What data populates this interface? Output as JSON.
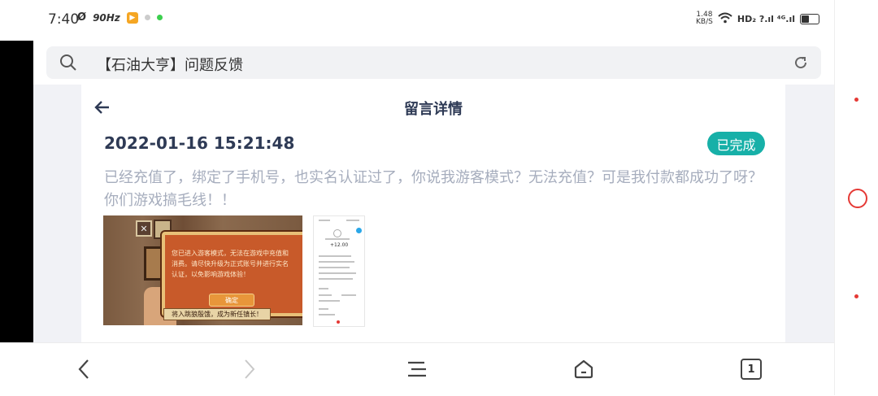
{
  "status_bar": {
    "time": "7:40",
    "refresh_rate": "90Hz",
    "speed_value": "1.48",
    "speed_unit": "KB/S",
    "network": "HD₂ ?.ıl ⁴ᴳ.ıl"
  },
  "browser": {
    "address_text": "【石油大亨】问题反馈",
    "tab_count": "1"
  },
  "page": {
    "title": "留言详情",
    "message_time": "2022-01-16 15:21:48",
    "status_badge": "已完成",
    "message_text": "已经充值了，绑定了手机号，也实名认证过了，你说我游客模式？无法充值？可是我付款都成功了呀？你们游戏搞毛线！！"
  },
  "attachments": {
    "screenshot1": {
      "dialog_text": "您已进入游客模式，无法在游戏中充值和消费。请尽快升级为正式账号并进行实名认证，以免影响游戏体验！",
      "ok_label": "确定",
      "caption": "将入跳狼殷饿，成为新任镇长！"
    },
    "screenshot2": {
      "amount": "+12.00"
    }
  },
  "colors": {
    "badge": "#17b0a8",
    "title": "#2e3a55",
    "message": "#a6adbd"
  }
}
